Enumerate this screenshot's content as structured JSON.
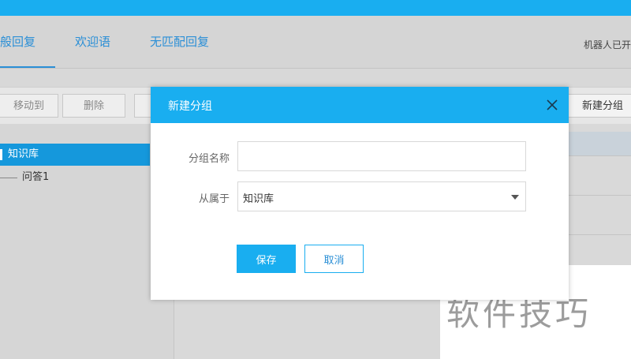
{
  "tabs": [
    {
      "label": "般回复",
      "active": true
    },
    {
      "label": "欢迎语",
      "active": false
    },
    {
      "label": "无匹配回复",
      "active": false
    }
  ],
  "robot_status": "机器人已开",
  "toolbar": {
    "move_to": "移动到",
    "delete": "删除",
    "new_group": "新建分组"
  },
  "tree": {
    "root_label": "知识库",
    "children": [
      "问答1"
    ]
  },
  "dialog": {
    "title": "新建分组",
    "group_name_label": "分组名称",
    "group_name_value": "",
    "parent_label": "从属于",
    "parent_value": "知识库",
    "save_label": "保存",
    "cancel_label": "取消"
  },
  "watermark": "软件技巧",
  "colors": {
    "accent": "#19aef0",
    "tree_selected": "#1598dc",
    "link_blue": "#2b8fd6"
  }
}
